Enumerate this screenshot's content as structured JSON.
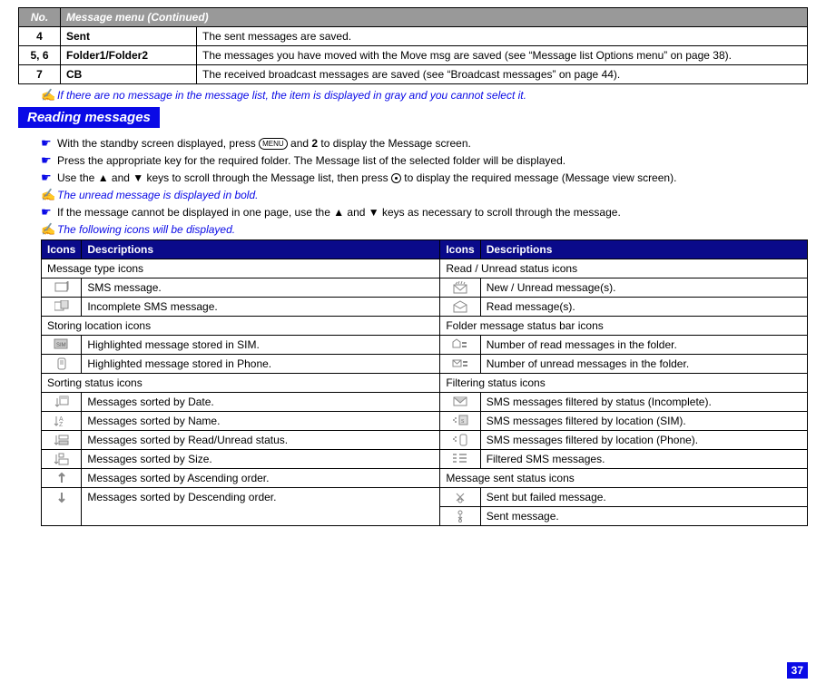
{
  "topTable": {
    "header": {
      "no": "No.",
      "menu": "Message menu (Continued)"
    },
    "rows": [
      {
        "no": "4",
        "name": "Sent",
        "desc": "The sent messages are saved."
      },
      {
        "no": "5, 6",
        "name": "Folder1/Folder2",
        "desc": "The messages you have moved with the Move msg are saved (see “Message list Options menu” on page 38)."
      },
      {
        "no": "7",
        "name": "CB",
        "desc": "The received broadcast messages are saved (see “Broadcast messages” on page 44)."
      }
    ]
  },
  "note1": "If there are no message in the message list, the item is displayed in gray and you cannot select it.",
  "sectionTitle": "Reading messages",
  "bullets": {
    "b1a": "With the standby screen displayed, press ",
    "b1b": " and ",
    "b1c": "2",
    "b1d": " to display the Message screen.",
    "b2": "Press the appropriate key for the required folder. The Message list of the selected folder will be displayed.",
    "b3a": "Use the ▲ and ▼ keys to scroll through the Message list, then press ",
    "b3b": " to display the required message (Message view screen).",
    "n2": "The unread message is displayed in bold.",
    "b4": "If the message cannot be displayed in one page, use the ▲ and ▼ keys as necessary to scroll through the message.",
    "n3": "The following icons will be displayed."
  },
  "menuBtn": "MENU",
  "iconsTable": {
    "header": {
      "icons": "Icons",
      "desc": "Descriptions"
    },
    "sections": {
      "msgType": "Message type icons",
      "readUnread": "Read / Unread status icons",
      "storing": "Storing location icons",
      "folderBar": "Folder message status bar icons",
      "sorting": "Sorting status icons",
      "filtering": "Filtering status icons",
      "sentStatus": "Message sent status icons"
    },
    "left": {
      "sms": "SMS message.",
      "incomplete": "Incomplete SMS message.",
      "sim": "Highlighted message stored in SIM.",
      "phone": "Highlighted message stored in Phone.",
      "byDate": "Messages sorted by Date.",
      "byName": "Messages sorted by Name.",
      "byRead": "Messages sorted by Read/Unread status.",
      "bySize": "Messages sorted by Size.",
      "asc": "Messages sorted by Ascending order.",
      "desc": "Messages sorted by Descending order."
    },
    "right": {
      "new": "New / Unread message(s).",
      "read": "Read message(s).",
      "numRead": "Number of read messages in the folder.",
      "numUnread": "Number of unread messages in the folder.",
      "fIncomplete": "SMS messages filtered by status (Incomplete).",
      "fSim": "SMS messages filtered by location (SIM).",
      "fPhone": "SMS messages filtered by location (Phone).",
      "fSms": "Filtered SMS messages.",
      "sentFail": "Sent but failed message.",
      "sent": "Sent message."
    }
  },
  "pageNum": "37"
}
